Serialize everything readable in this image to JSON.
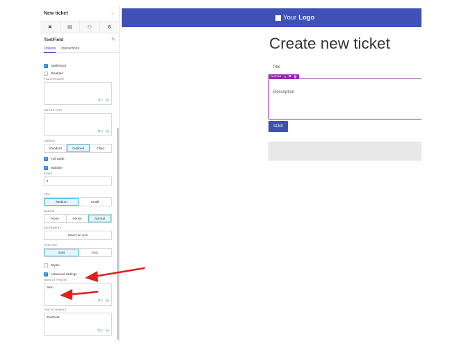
{
  "panel": {
    "title": "New ticket",
    "title_check": "✓",
    "toolbar": [
      "✖",
      "▤",
      "⚇",
      "⚙"
    ],
    "component_name": "TextField",
    "component_edit": "✎",
    "tabs": [
      "Options",
      "Interactions"
    ]
  },
  "options": {
    "spellcheck": "Spellcheck",
    "disabled": "Disabled",
    "placeholder_label": "PLACEHOLDER",
    "helper_text_label": "HELPER TEXT",
    "translate_icon": "文A",
    "var_icon": "{x}",
    "variant_label": "VARIANT",
    "variant": [
      "Standard",
      "Outlined",
      "Filled"
    ],
    "full_width": "Full width",
    "multiline": "Multiline",
    "rows_label": "ROWS",
    "rows_value": "4",
    "size_label": "SIZE",
    "size": [
      "Medium",
      "Small"
    ],
    "margin_label": "MARGIN",
    "margin": [
      "None",
      "Dense",
      "Normal"
    ],
    "adornment_label": "ADORNMENT",
    "adornment_button": "Select an icon",
    "position_label": "POSITION",
    "position": [
      "Start",
      "End"
    ],
    "styles": "Styles",
    "advanced": "Advanced settings",
    "name_attr_label": "NAME ATTRIBUTE",
    "name_attr_value": "desc",
    "test_attr_label": "TEST ATTRIBUTE",
    "test_attr_value": "TextField"
  },
  "canvas": {
    "logo_text_light": "Your",
    "logo_text_bold": "Logo",
    "page_title": "Create new ticket",
    "title_field": "Title",
    "selected_tag": "TextField",
    "tag_icons": [
      "✎",
      "⧉",
      "🗑"
    ],
    "description_field": "Description",
    "send_button": "SEND"
  },
  "colors": {
    "appbar": "#3f51b5",
    "selection": "#9c27b0",
    "checkbox": "#2b8ad9",
    "arrow": "#e01e1e"
  }
}
